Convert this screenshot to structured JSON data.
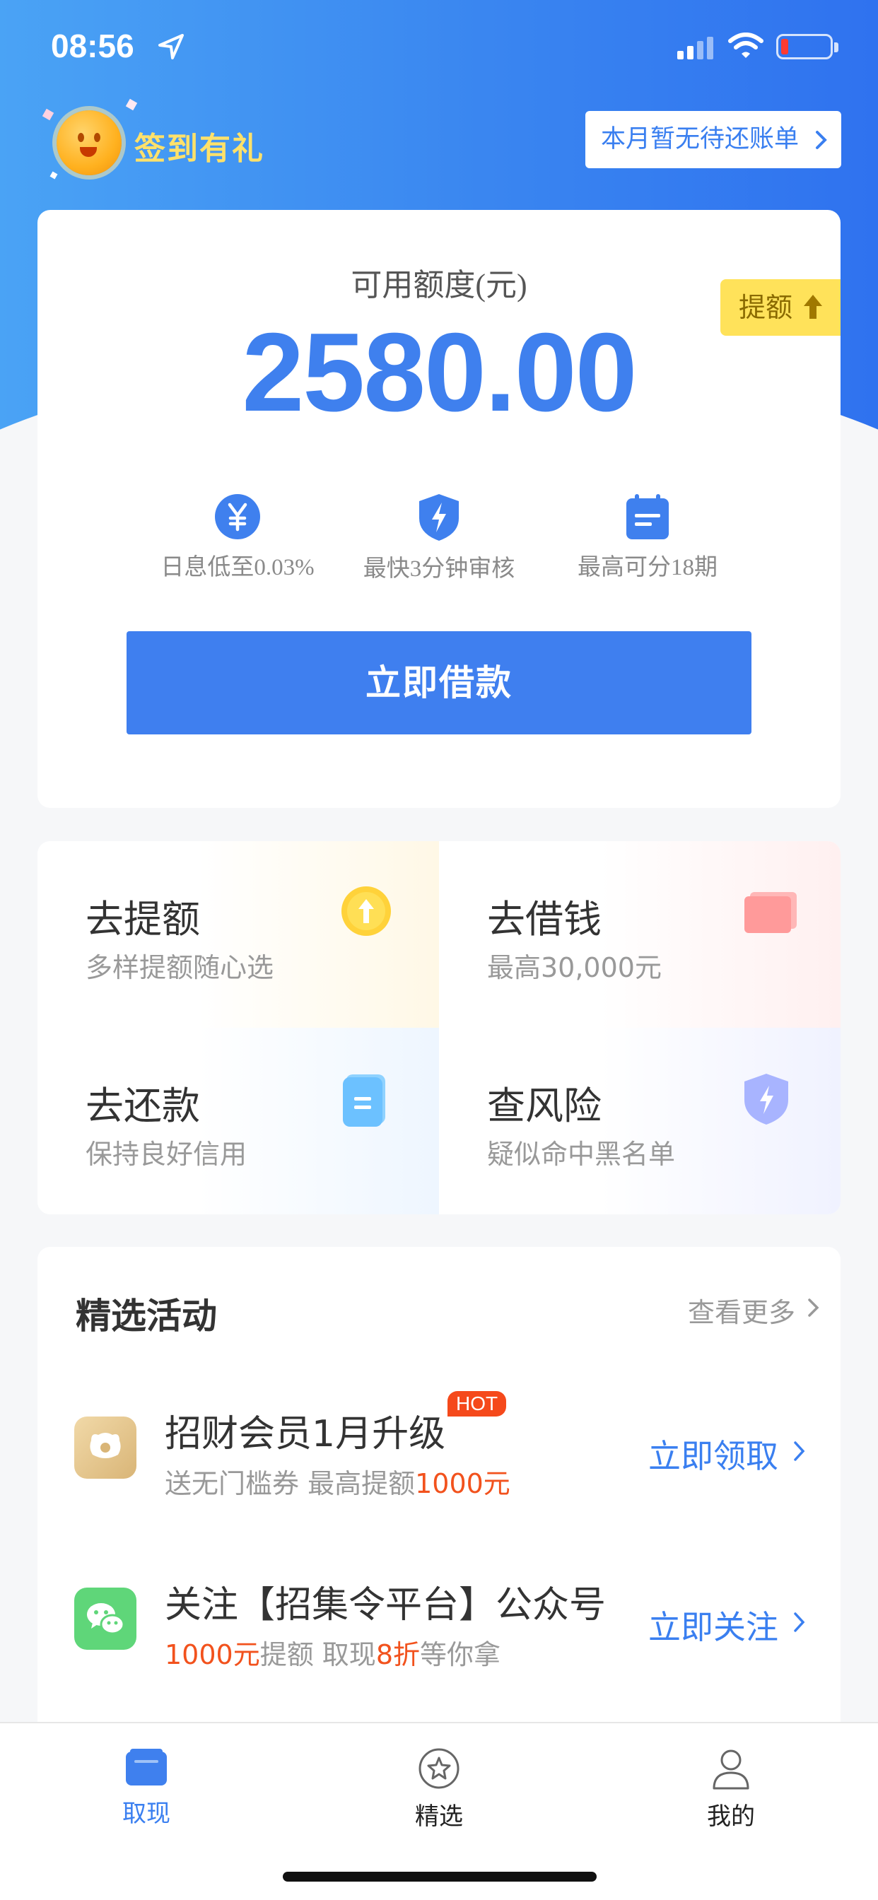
{
  "status_bar": {
    "time": "08:56"
  },
  "header": {
    "signin_label": "签到有礼",
    "bill_button": "本月暂无待还账单"
  },
  "quota": {
    "label": "可用额度(元)",
    "amount": "2580.00",
    "raise_tag": "提额"
  },
  "features": [
    {
      "icon": "yuan-icon",
      "text": "日息低至0.03%"
    },
    {
      "icon": "lightning-shield-icon",
      "text": "最快3分钟审核"
    },
    {
      "icon": "calendar-icon",
      "text": "最高可分18期"
    }
  ],
  "borrow_button": "立即借款",
  "grid": [
    {
      "title": "去提额",
      "subtitle": "多样提额随心选",
      "icon": "up-arrow-coin-icon"
    },
    {
      "title": "去借钱",
      "subtitle": "最高30,000元",
      "icon": "card-icon"
    },
    {
      "title": "去还款",
      "subtitle": "保持良好信用",
      "icon": "document-icon"
    },
    {
      "title": "查风险",
      "subtitle": "疑似命中黑名单",
      "icon": "shield-icon"
    }
  ],
  "activities": {
    "title": "精选活动",
    "more": "查看更多",
    "items": [
      {
        "name": "招财会员1月升级",
        "badge": "HOT",
        "sub_a": "送无门槛券 最高提额",
        "sub_hl": "1000元",
        "cta": "立即领取",
        "icon": "member-icon"
      },
      {
        "name": "关注【招集令平台】公众号",
        "sub_hl1": "1000元",
        "sub_b": "提额 取现",
        "sub_hl2": "8折",
        "sub_c": "等你拿",
        "cta": "立即关注",
        "icon": "wechat-icon"
      }
    ]
  },
  "tabs": [
    {
      "label": "取现",
      "icon": "wallet-icon",
      "active": true
    },
    {
      "label": "精选",
      "icon": "star-circle-icon",
      "active": false
    },
    {
      "label": "我的",
      "icon": "user-icon",
      "active": false
    }
  ],
  "colors": {
    "primary": "#3f80ee",
    "highlight": "#f2521d",
    "raise_tag": "#ffe25a"
  }
}
